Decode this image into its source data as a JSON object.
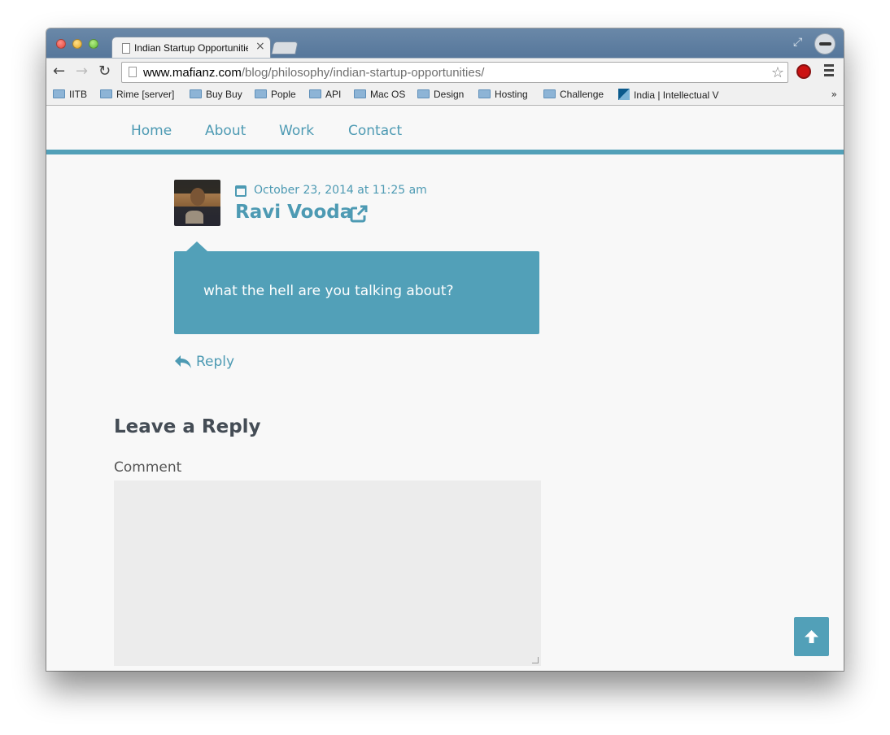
{
  "browser": {
    "tab_title": "Indian Startup Opportunities",
    "tab_close": "×",
    "url_host": "www.mafianz.com",
    "url_path": "/blog/philosophy/indian-startup-opportunities/",
    "bookmarks": [
      {
        "label": "IITB",
        "icon": "folder-icon"
      },
      {
        "label": "Rime [server]",
        "icon": "folder-icon"
      },
      {
        "label": "Buy Buy",
        "icon": "folder-icon"
      },
      {
        "label": "Pople",
        "icon": "folder-icon"
      },
      {
        "label": "API",
        "icon": "folder-icon"
      },
      {
        "label": "Mac OS",
        "icon": "folder-icon"
      },
      {
        "label": "Design",
        "icon": "folder-icon"
      },
      {
        "label": "Hosting",
        "icon": "folder-icon"
      },
      {
        "label": "Challenge",
        "icon": "folder-icon"
      },
      {
        "label": "India | Intellectual V",
        "icon": "site-icon"
      }
    ],
    "bookmarks_more": "»"
  },
  "nav": {
    "items": [
      "Home",
      "About",
      "Work",
      "Contact"
    ]
  },
  "comment": {
    "date": "October 23, 2014 at 11:25 am",
    "author": "Ravi Vooda",
    "text": "what the hell are you talking about?",
    "reply_label": "Reply"
  },
  "reply_form": {
    "heading": "Leave a Reply",
    "comment_label": "Comment",
    "comment_value": ""
  },
  "colors": {
    "accent": "#52a0b8",
    "link": "#4d9ab3",
    "heading": "#444c55",
    "textarea_bg": "#ececec"
  },
  "icons": [
    "calendar-icon",
    "external-link-icon",
    "reply-icon",
    "arrow-up-icon",
    "star-icon",
    "folder-icon"
  ]
}
